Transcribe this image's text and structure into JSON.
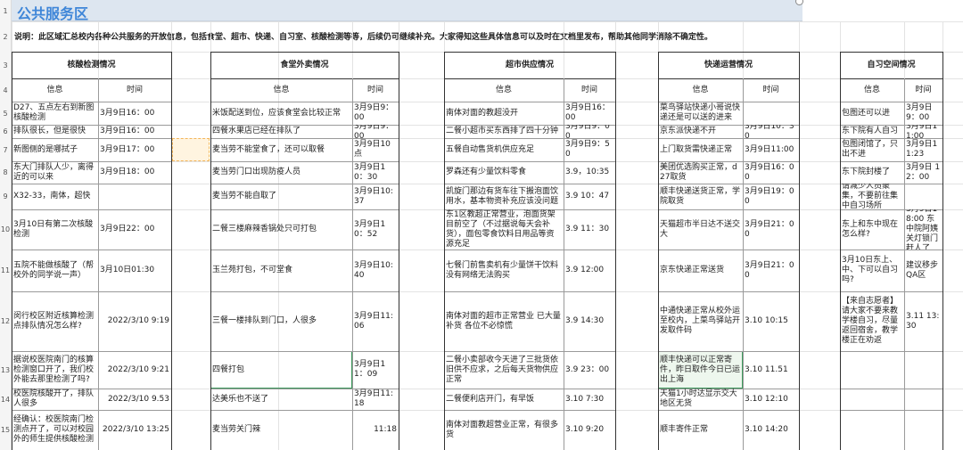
{
  "title": "公共服务区",
  "note": "说明：此区域汇总校内各种公共服务的开放信息，包括食堂、超市、快递、自习室、核酸检测等等，后续仍可继续补充。大家得知这些具体信息可以及时在文档里发布，帮助其他同学消除不确定性。",
  "row_numbers": [
    "1",
    "2",
    "3",
    "4",
    "5",
    "6",
    "7",
    "8",
    "9",
    "10",
    "11",
    "12",
    "13",
    "14",
    "15"
  ],
  "sections": [
    {
      "title": "核酸检测情况",
      "col_info": "信息",
      "col_time": "时间",
      "rows": [
        [
          "D27、五点左右到新图核酸检测",
          "3月9日16：00"
        ],
        [
          "排队很长，但是很快",
          "3月9日16：00"
        ],
        [
          "新图侧的是哪拭子",
          "3月9日17：00"
        ],
        [
          "东大门排队人少，离得近的可以来",
          "3月9日18：00"
        ],
        [
          "X32-33，南体，超快",
          ""
        ],
        [
          "3月10日有第二次核酸检测",
          "3月9日22：00"
        ],
        [
          "五院不能做核酸了（帮校外的同学说一声）",
          "3月10日01:30"
        ],
        [
          "闵行校区附近核算检测点排队情况怎么样?",
          "2022/3/10 9:19"
        ],
        [
          "据说校医院南门的核算检测窗口开了，我们校外能去那里检测了吗?",
          "2022/3/10 9:21"
        ],
        [
          "校医院核酸开了，排队人很多",
          "2022/3/10 9.53"
        ],
        [
          "经确认：校医院南门检测点开了，可以对校园外的师生提供核酸检测",
          "2022/3/10 13:25"
        ]
      ]
    },
    {
      "title": "食堂外卖情况",
      "col_info": "信息",
      "col_time": "时间",
      "rows": [
        [
          "米饭配送到位，应该食堂会比较正常",
          "3月9日9：00"
        ],
        [
          "四餐水果店已经在排队了",
          "3月9日9：00"
        ],
        [
          "麦当劳不能堂食了，还可以取餐",
          "3月9日10点"
        ],
        [
          "麦当劳门口出现防疫人员",
          "3月9日10：30"
        ],
        [
          "麦当劳不能自取了",
          "3月9日10:37"
        ],
        [
          "二餐三楼麻辣香锅处只可打包",
          "3月9日10：52"
        ],
        [
          "玉兰苑打包，不可堂食",
          "3月9日10:40"
        ],
        [
          "三餐一楼排队到门口，人很多",
          "3月9日11:06"
        ],
        [
          "四餐打包",
          "3月9日11：09"
        ],
        [
          "达美乐也不送了",
          "3月9日11:18"
        ],
        [
          "麦当劳关门辣",
          "11:18"
        ]
      ]
    },
    {
      "title": "超市供应情况",
      "col_info": "信息",
      "col_time": "时间",
      "rows": [
        [
          "南体对面的教超没开",
          "3月9日16：00"
        ],
        [
          "二餐小超市买东西排了四十分钟",
          "3月9日9：00"
        ],
        [
          "五餐自动售货机供应充足",
          "3月9日9：50"
        ],
        [
          "罗森还有少量饮料零食",
          "3.9，10:35"
        ],
        [
          "凯旋门那边有货车往下搬泡面饮用水，基本物资补充应该没问题",
          "3.9 10：47"
        ],
        [
          "东1区教超正常营业，泡面货架目前空了（不过据说每天会补货），面包零食饮料日用品等资源充足",
          "3.9 11：30"
        ],
        [
          "七餐门前售卖机有少量饼干饮料没有网络无法购买",
          "3.9 12:00"
        ],
        [
          "南体对面的超市正常营业 已大量补货 各位不必惊慌",
          "3.9 14:30"
        ],
        [
          "二餐小卖部收今天进了三批货依旧供不应求，之后每天货物供应正常",
          "3.9 23：00"
        ],
        [
          "二餐便利店开门，有早饭",
          "3.10 7:30"
        ],
        [
          "南体对面教超营业正常，有很多货",
          "3.10 9:20"
        ]
      ]
    },
    {
      "title": "快递运营情况",
      "col_info": "信息",
      "col_time": "时间",
      "rows": [
        [
          "菜鸟驿站快递小哥说快递还是可以送的进来",
          ""
        ],
        [
          "京东派快递不开",
          "3月9日10：30"
        ],
        [
          "上门取货需快递正常",
          "3月9日11:00"
        ],
        [
          "美团优选购买正常，d27取货",
          "3月9日16：00"
        ],
        [
          "顺丰快递送货正常，学院取货",
          "3月9日19：00"
        ],
        [
          "天猫超市半日达不送交大",
          "3月9日21：00"
        ],
        [
          "京东快递正常送货",
          "3月9日21：00"
        ],
        [
          "中通快递正常从校外运至校内，上菜鸟驿站开发取件码",
          "3.10 10:15"
        ],
        [
          "顺丰快递可以正常寄件，昨日取件今日已运出上海",
          "3.10 11.51"
        ],
        [
          "天猫1小时达显示交大地区无货",
          "3.10 12:10"
        ],
        [
          "顺丰寄件正常",
          "3.10 14:20"
        ]
      ]
    },
    {
      "title": "自习空间情况",
      "col_info": "信息",
      "col_time": "时间",
      "rows": [
        [
          "包图还可以进",
          "3月9日9：00"
        ],
        [
          "东下院有人自习",
          "3月9日11:00"
        ],
        [
          "包图闭馆了，只出不进",
          "3月9日11:23"
        ],
        [
          "东下院封楼了",
          "3月9日 12：00"
        ],
        [
          "请减少人员聚集，不要前往集中自习场所",
          ""
        ],
        [
          "东上和东中现在怎么样?",
          "3月9日18:00 东中院阿姨关灯锁门赶人了"
        ],
        [
          "3月10日东上、中、下可以自习吗?",
          "建议移步QA区"
        ],
        [
          "【来自志愿者】请大家不要来教学楼自习，尽量返回宿舍，教学楼正在劝返",
          "3.11 13:30"
        ],
        [
          "",
          ""
        ],
        [
          "",
          ""
        ],
        [
          "",
          ""
        ]
      ]
    }
  ]
}
